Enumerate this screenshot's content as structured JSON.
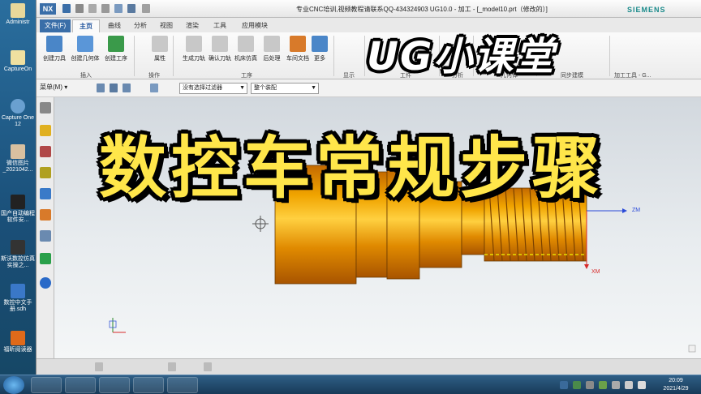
{
  "desktop": {
    "icons": [
      {
        "label": "Administr"
      },
      {
        "label": "CaptureOn"
      },
      {
        "label": "Capture One 12"
      },
      {
        "label": "微信图片_2021042..."
      },
      {
        "label": "国产自动编程软件安..."
      },
      {
        "label": "斯沃数控仿真实操之..."
      },
      {
        "label": "数控中文手册.sdh"
      },
      {
        "label": "福昕阅读器"
      }
    ]
  },
  "window": {
    "logo": "NX",
    "title": "专业CNC培训,视频教程请联系QQ-434324903 UG10.0 - 加工 - [_model10.prt（修改的）]",
    "brand": "SIEMENS"
  },
  "tabs": [
    "文件(F)",
    "主页",
    "曲线",
    "分析",
    "视图",
    "渲染",
    "工具",
    "应用模块"
  ],
  "ribbon": {
    "buttons": [
      {
        "label": "创建刀具",
        "color": "#4a86c8"
      },
      {
        "label": "创建几何体",
        "color": "#5a96d8"
      },
      {
        "label": "创建工序",
        "color": "#3a9a4a"
      },
      {
        "label": "属性",
        "color": "#b0b0b0"
      },
      {
        "label": "生成刀轨",
        "color": "#b0b0b0"
      },
      {
        "label": "确认刀轨",
        "color": "#b0b0b0"
      },
      {
        "label": "机床仿真",
        "color": "#b0b0b0"
      },
      {
        "label": "后处理",
        "color": "#b0b0b0"
      },
      {
        "label": "车间文档",
        "color": "#d87a2a"
      },
      {
        "label": "更多",
        "color": "#4a86c8"
      }
    ],
    "groups": [
      "插入",
      "操作",
      "工序",
      "显示",
      "工件",
      "分析",
      "几何体",
      "同步建模",
      "加工工具 - G..."
    ]
  },
  "toolbar2": {
    "menu": "菜单(M) ▾",
    "filter": "没有选择过滤器",
    "assembly": "整个装配"
  },
  "overlay": {
    "top": "UG小课堂",
    "main": "数控车常规步骤"
  },
  "axes": {
    "zm": "ZM",
    "xm": "XM"
  },
  "clock": {
    "time": "20:09",
    "date": "2021/4/29"
  }
}
